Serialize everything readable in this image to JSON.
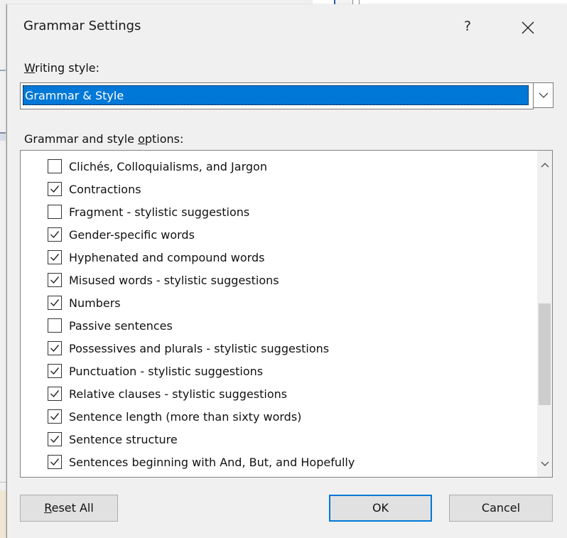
{
  "dialog": {
    "title": "Grammar Settings",
    "help_label": "?",
    "writing_style_label_prefix": "",
    "writing_style_label_ul": "W",
    "writing_style_label_rest": "riting style:",
    "writing_style_value": "Grammar & Style",
    "options_label_prefix": "Grammar and style ",
    "options_label_ul": "o",
    "options_label_rest": "ptions:",
    "options": [
      {
        "label": "Clichés, Colloquialisms, and Jargon",
        "checked": false
      },
      {
        "label": "Contractions",
        "checked": true
      },
      {
        "label": "Fragment - stylistic suggestions",
        "checked": false
      },
      {
        "label": "Gender-specific words",
        "checked": true
      },
      {
        "label": "Hyphenated and compound words",
        "checked": true
      },
      {
        "label": "Misused words - stylistic suggestions",
        "checked": true
      },
      {
        "label": "Numbers",
        "checked": true
      },
      {
        "label": "Passive sentences",
        "checked": false
      },
      {
        "label": "Possessives and plurals - stylistic suggestions",
        "checked": true
      },
      {
        "label": "Punctuation - stylistic suggestions",
        "checked": true
      },
      {
        "label": "Relative clauses - stylistic suggestions",
        "checked": true
      },
      {
        "label": "Sentence length (more than sixty words)",
        "checked": true
      },
      {
        "label": "Sentence structure",
        "checked": true
      },
      {
        "label": "Sentences beginning with And, But, and Hopefully",
        "checked": true
      }
    ],
    "buttons": {
      "reset_ul": "R",
      "reset_rest": "eset All",
      "ok": "OK",
      "cancel": "Cancel"
    }
  },
  "colors": {
    "selection": "#0078d7",
    "dialog_bg": "#f0f0f0",
    "default_button_border": "#0078d7"
  }
}
